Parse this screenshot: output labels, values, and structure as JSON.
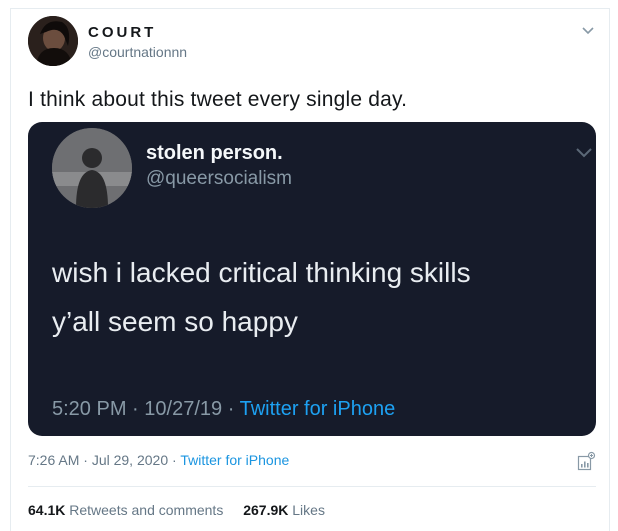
{
  "author": {
    "display_name": "COURT",
    "handle": "@courtnationnn"
  },
  "tweet": {
    "text": "I think about this tweet every single day."
  },
  "embedded_tweet": {
    "display_name": "stolen person.",
    "handle": "@queersocialism",
    "lines": [
      "wish i lacked critical thinking skills",
      "y’all seem so happy"
    ],
    "time": "5:20 PM",
    "date": "10/27/19",
    "separator": "·",
    "source": "Twitter for iPhone"
  },
  "meta": {
    "time": "7:26 AM",
    "date": "Jul 29, 2020",
    "separator": "·",
    "source": "Twitter for iPhone"
  },
  "stats": {
    "retweets_count": "64.1K",
    "retweets_label": "Retweets and comments",
    "likes_count": "267.9K",
    "likes_label": "Likes"
  },
  "icons": {
    "caret": "chevron-down-icon",
    "analytics": "analytics-icon"
  },
  "colors": {
    "link": "#1b95e0",
    "embed_bg": "#161b2a",
    "muted": "#657786"
  }
}
